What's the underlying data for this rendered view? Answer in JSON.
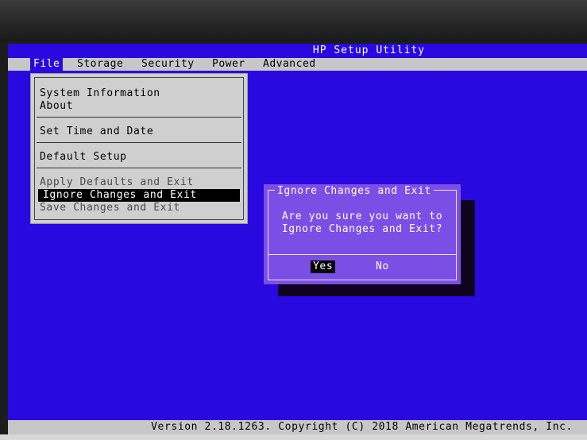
{
  "title": "HP Setup Utility",
  "menu": [
    {
      "label": "File",
      "active": true
    },
    {
      "label": "Storage",
      "active": false
    },
    {
      "label": "Security",
      "active": false
    },
    {
      "label": "Power",
      "active": false
    },
    {
      "label": "Advanced",
      "active": false
    }
  ],
  "file_menu": {
    "items": [
      "System Information",
      "About",
      "Set Time and Date",
      "Default Setup",
      "Apply Defaults and Exit",
      "Ignore Changes and Exit",
      "Save Changes and Exit"
    ],
    "selected": "Ignore Changes and Exit"
  },
  "dialog": {
    "title": "Ignore Changes and Exit",
    "message_line1": "Are you sure you want to",
    "message_line2": "Ignore Changes and Exit?",
    "yes_label": "Yes",
    "no_label": "No",
    "selected": "Yes"
  },
  "status": "Version 2.18.1263. Copyright (C) 2018 American Megatrends, Inc.",
  "colors": {
    "background": "#2a08e0",
    "menu_bar": "#c7c7c7",
    "dialog": "#7b4fe6",
    "selection": "#000000"
  }
}
